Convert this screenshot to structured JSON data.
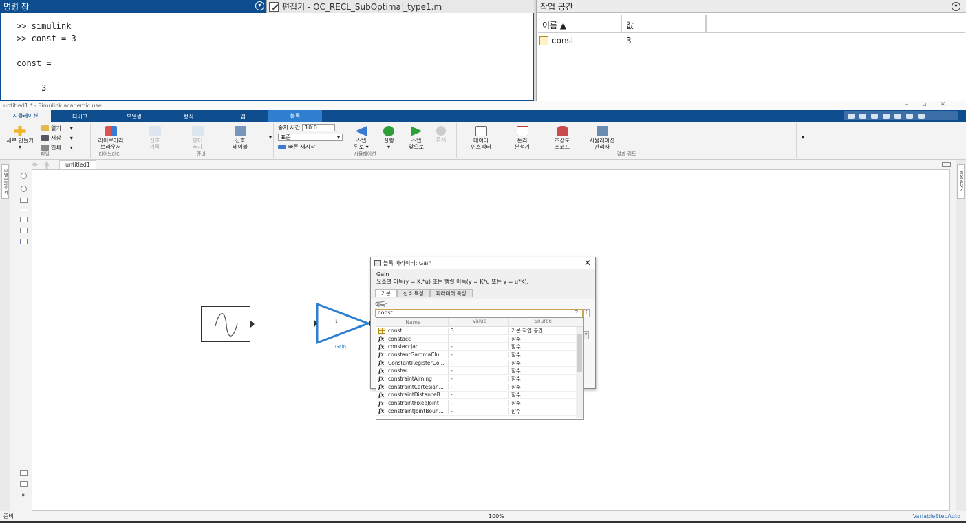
{
  "command_window": {
    "title": "명령 창",
    "lines": [
      ">> simulink",
      ">> const = 3",
      "",
      "const =",
      "",
      "     3"
    ]
  },
  "editor_tab": {
    "label": "편집기 - OC_RECL_SubOptimal_type1.m"
  },
  "workspace": {
    "title": "작업 공간",
    "col_name": "이름 ▲",
    "col_value": "값",
    "rows": [
      {
        "name": "const",
        "value": "3"
      }
    ]
  },
  "simulink": {
    "window_title": "untitled1 * - Simulink academic use",
    "tabs": [
      "시뮬레이션",
      "디버그",
      "모델링",
      "형식",
      "앱",
      "블록"
    ],
    "active_tab": "시뮬레이션",
    "file": {
      "new": "새로 만들기",
      "open": "열기",
      "save": "저장",
      "print": "인쇄",
      "label": "파일"
    },
    "library": {
      "browser_l1": "라이브러리",
      "browser_l2": "브라우저",
      "label": "라이브러리"
    },
    "prepare": {
      "signal_log_l1": "신호",
      "signal_log_l2": "기록",
      "add_viewer_l1": "뷰어",
      "add_viewer_l2": "추가",
      "signal_table_l1": "신호",
      "signal_table_l2": "테이블",
      "label": "준비"
    },
    "simulate": {
      "stop_time_label": "중지 시간",
      "stop_time": "10.0",
      "mode": "표준",
      "fast_restart": "빠른 재시작",
      "step_back_l1": "스텝",
      "step_back_l2": "뒤로",
      "run": "실행",
      "step_fwd_l1": "스텝",
      "step_fwd_l2": "앞으로",
      "stop": "중지",
      "label": "시뮬레이션"
    },
    "review": {
      "data_insp_l1": "데이터",
      "data_insp_l2": "인스펙터",
      "logic_l1": "논리",
      "logic_l2": "분석기",
      "bird_l1": "조감도",
      "bird_l2": "스코프",
      "sim_mgr_l1": "시뮬레이션",
      "sim_mgr_l2": "관리자",
      "label": "결과 검토"
    },
    "left_strip": "모델 브라우저",
    "right_strip": "속성 검사기",
    "breadcrumb": "untitled1",
    "status": {
      "ready": "준비",
      "zoom": "100%",
      "solver": "VariableStepAuto"
    },
    "gain_block": {
      "value": "1",
      "name": "Gain"
    }
  },
  "dialog": {
    "title": "블록 파라미터: Gain",
    "block_type": "Gain",
    "description": "요소별 이득(y = K.*u) 또는 행렬 이득(y = K*u 또는 y = u*K).",
    "tabs": [
      "기본",
      "신호 특성",
      "파라미터 특성"
    ],
    "gain_label": "이득:",
    "gain_value": "const",
    "gain_hint": "3"
  },
  "autocomplete": {
    "headers": [
      "Name",
      "Value",
      "Source"
    ],
    "rows": [
      {
        "icon": "variable",
        "name": "const",
        "value": "3",
        "source": "기본 작업 공간"
      },
      {
        "icon": "fx",
        "name": "constacc",
        "value": "-",
        "source": "함수"
      },
      {
        "icon": "fx",
        "name": "constaccjac",
        "value": "-",
        "source": "함수"
      },
      {
        "icon": "fx",
        "name": "constantGammaClu...",
        "value": "-",
        "source": "함수"
      },
      {
        "icon": "fx",
        "name": "ConstantRegisterCo...",
        "value": "-",
        "source": "함수"
      },
      {
        "icon": "fx",
        "name": "constar",
        "value": "-",
        "source": "함수"
      },
      {
        "icon": "fx",
        "name": "constraintAiming",
        "value": "-",
        "source": "함수"
      },
      {
        "icon": "fx",
        "name": "constraintCartesian...",
        "value": "-",
        "source": "함수"
      },
      {
        "icon": "fx",
        "name": "constraintDistanceB...",
        "value": "-",
        "source": "함수"
      },
      {
        "icon": "fx",
        "name": "constraintFixedJoint",
        "value": "-",
        "source": "함수"
      },
      {
        "icon": "fx",
        "name": "constraintJointBoun...",
        "value": "-",
        "source": "함수"
      }
    ]
  },
  "colors": {
    "matlab_blue": "#0e4e8e",
    "accent": "#2f7fd1",
    "selection": "#caa34a"
  }
}
